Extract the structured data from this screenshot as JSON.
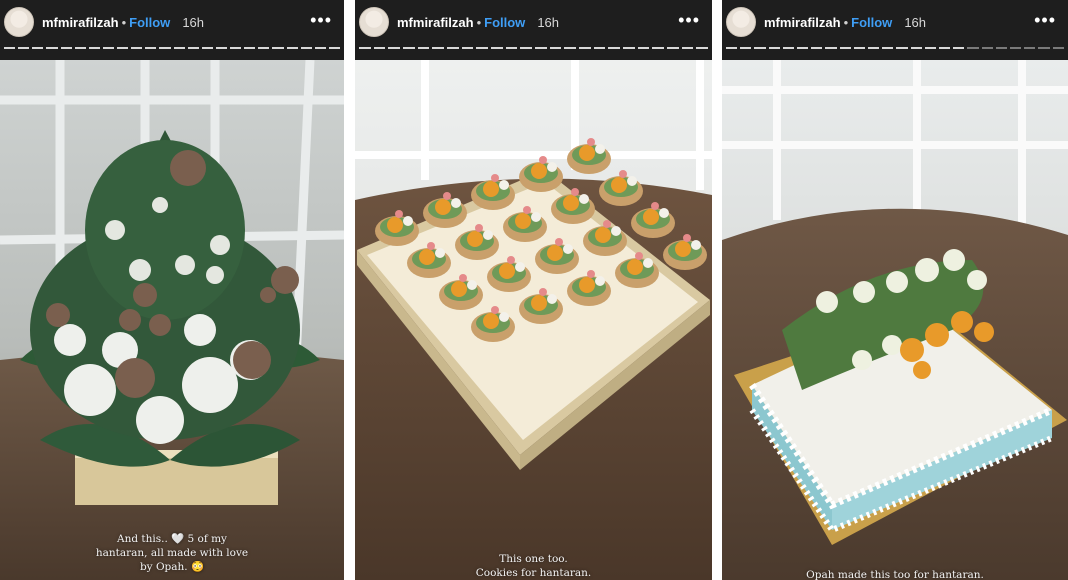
{
  "stories": [
    {
      "username": "mfmirafilzah",
      "separator": "•",
      "follow_label": "Follow",
      "time": "16h",
      "more_icon": "more-horizontal-icon",
      "caption_lines": [
        "And this.. 🤍 5 of my",
        "hantaran, all made with love",
        "by Opah. 😳"
      ]
    },
    {
      "username": "mfmirafilzah",
      "separator": "•",
      "follow_label": "Follow",
      "time": "16h",
      "more_icon": "more-horizontal-icon",
      "caption_lines": [
        "This one too.",
        "Cookies for hantaran."
      ]
    },
    {
      "username": "mfmirafilzah",
      "separator": "•",
      "follow_label": "Follow",
      "time": "16h",
      "more_icon": "more-horizontal-icon",
      "caption_lines": [
        "Opah made this too for hantaran."
      ]
    }
  ],
  "colors": {
    "story_bg": "#1e1e1e",
    "follow": "#3f9ef5",
    "cake_blue": "#9fd3da",
    "flower_orange": "#e89a2a"
  }
}
